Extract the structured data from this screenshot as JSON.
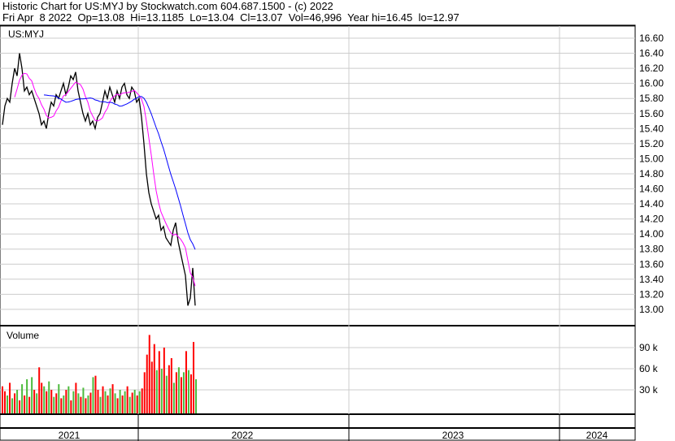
{
  "header": {
    "line1": "Historic Chart for US:MYJ by Stockwatch.com 604.687.1500 - (c) 2022",
    "line2": "Fri Apr  8 2022  Op=13.08  Hi=13.1185  Lo=13.04  Cl=13.07  Vol=46,996  Year hi=16.45  lo=12.97"
  },
  "chart_data": [
    {
      "type": "line",
      "title": "US:MYJ",
      "ylim": [
        12.8,
        16.7
      ],
      "yticks": [
        "16.60",
        "16.40",
        "16.20",
        "16.00",
        "15.80",
        "15.60",
        "15.40",
        "15.20",
        "15.00",
        "14.80",
        "14.60",
        "14.40",
        "14.20",
        "14.00",
        "13.80",
        "13.60",
        "13.40",
        "13.20",
        "13.00"
      ],
      "x_years": [
        "2021",
        "2022",
        "2023",
        "2024"
      ],
      "series": [
        {
          "name": "Price",
          "color": "#000000",
          "values": [
            15.45,
            15.7,
            15.8,
            15.75,
            16.0,
            16.2,
            16.1,
            16.4,
            16.2,
            15.9,
            15.95,
            15.85,
            15.9,
            15.8,
            15.7,
            15.6,
            15.45,
            15.5,
            15.4,
            15.6,
            15.75,
            15.7,
            15.85,
            15.8,
            15.9,
            16.0,
            15.85,
            15.95,
            16.1,
            16.05,
            16.15,
            15.9,
            15.75,
            15.6,
            15.5,
            15.6,
            15.45,
            15.5,
            15.4,
            15.55,
            15.6,
            15.75,
            15.9,
            15.8,
            15.95,
            15.85,
            15.75,
            15.9,
            15.8,
            15.95,
            16.0,
            15.85,
            15.8,
            15.95,
            15.9,
            15.75,
            15.8,
            15.55,
            15.2,
            14.8,
            14.55,
            14.4,
            14.3,
            14.2,
            14.25,
            14.05,
            14.1,
            13.95,
            13.9,
            13.85,
            14.05,
            14.15,
            13.9,
            13.75,
            13.6,
            13.45,
            13.05,
            13.15,
            13.55,
            13.05
          ]
        },
        {
          "name": "MA short",
          "color": "#ff00ff",
          "period": 6
        },
        {
          "name": "MA long",
          "color": "#0000ff",
          "period": 18
        }
      ]
    },
    {
      "type": "bar",
      "title": "Volume",
      "yticks": [
        "90 k",
        "60 k",
        "30 k"
      ],
      "unit": "k",
      "values": [
        35,
        28,
        22,
        40,
        18,
        25,
        30,
        15,
        38,
        22,
        45,
        20,
        48,
        30,
        25,
        62,
        40,
        35,
        28,
        42,
        30,
        20,
        25,
        38,
        18,
        22,
        30,
        35,
        15,
        28,
        40,
        25,
        20,
        33,
        18,
        22,
        26,
        48,
        50,
        30,
        20,
        35,
        28,
        22,
        32,
        38,
        25,
        18,
        30,
        22,
        28,
        35,
        20,
        26,
        30,
        22,
        28,
        32,
        55,
        80,
        108,
        70,
        95,
        58,
        85,
        60,
        90,
        50,
        65,
        75,
        40,
        55,
        62,
        48,
        55,
        85,
        58,
        52,
        98,
        45
      ],
      "colors": [
        "r",
        "r",
        "g",
        "r",
        "g",
        "r",
        "g",
        "r",
        "g",
        "r",
        "g",
        "r",
        "g",
        "r",
        "g",
        "r",
        "r",
        "g",
        "r",
        "g",
        "r",
        "g",
        "r",
        "g",
        "r",
        "g",
        "r",
        "g",
        "r",
        "g",
        "r",
        "g",
        "r",
        "g",
        "r",
        "g",
        "r",
        "g",
        "r",
        "r",
        "g",
        "r",
        "g",
        "r",
        "g",
        "r",
        "g",
        "r",
        "g",
        "r",
        "g",
        "r",
        "g",
        "r",
        "g",
        "r",
        "g",
        "r",
        "r",
        "r",
        "r",
        "r",
        "r",
        "g",
        "r",
        "g",
        "r",
        "g",
        "r",
        "r",
        "g",
        "r",
        "g",
        "r",
        "g",
        "r",
        "g",
        "r",
        "r",
        "g"
      ],
      "ylim": [
        0,
        120
      ]
    }
  ]
}
